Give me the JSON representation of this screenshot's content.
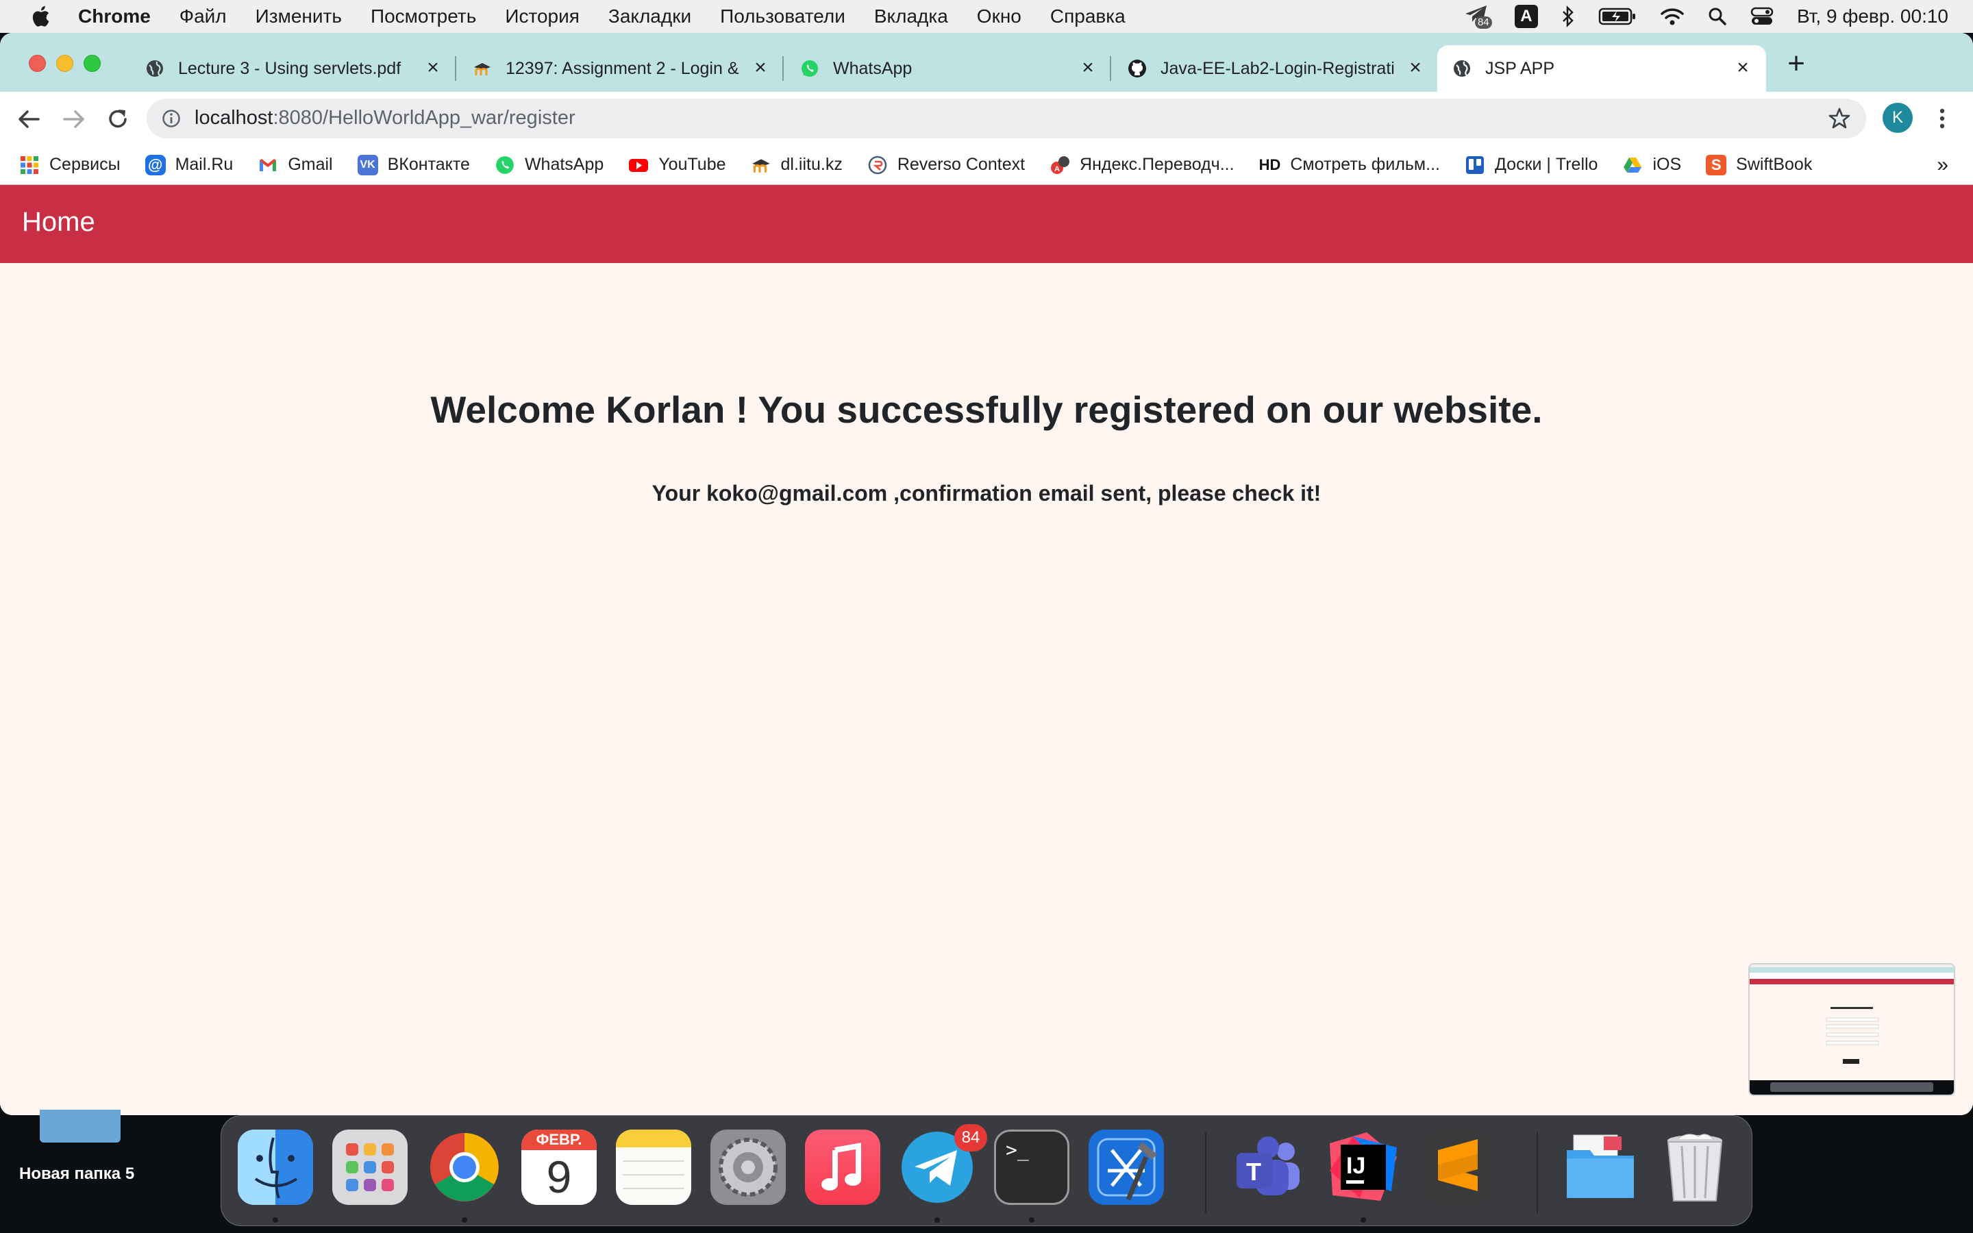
{
  "menubar": {
    "app_name": "Chrome",
    "items": [
      "Файл",
      "Изменить",
      "Посмотреть",
      "История",
      "Закладки",
      "Пользователи",
      "Вкладка",
      "Окно",
      "Справка"
    ],
    "status_badge": "84",
    "input_source": "A",
    "clock": "Вт, 9 февр.  00:10"
  },
  "tabs": [
    {
      "label": "Lecture 3 - Using servlets.pdf",
      "icon": "globe-icon"
    },
    {
      "label": "12397: Assignment 2 - Login &",
      "icon": "moodle-icon"
    },
    {
      "label": "WhatsApp",
      "icon": "whatsapp-icon"
    },
    {
      "label": "Java-EE-Lab2-Login-Registrati",
      "icon": "github-icon"
    },
    {
      "label": "JSP APP",
      "icon": "globe-icon",
      "active": true
    }
  ],
  "address": {
    "host": "localhost",
    "path": ":8080/HelloWorldApp_war/register"
  },
  "profile_initial": "K",
  "bookmarks": [
    {
      "label": "Сервисы",
      "icon": "apps-grid-icon"
    },
    {
      "label": "Mail.Ru",
      "icon": "mailru-icon"
    },
    {
      "label": "Gmail",
      "icon": "gmail-icon"
    },
    {
      "label": "ВКонтакте",
      "icon": "vk-icon"
    },
    {
      "label": "WhatsApp",
      "icon": "whatsapp-icon"
    },
    {
      "label": "YouTube",
      "icon": "youtube-icon"
    },
    {
      "label": "dl.iitu.kz",
      "icon": "moodle-icon"
    },
    {
      "label": "Reverso Context",
      "icon": "reverso-icon"
    },
    {
      "label": "Яндекс.Переводч...",
      "icon": "yandex-translate-icon"
    },
    {
      "label": "Смотреть фильм...",
      "icon": "hd-icon",
      "icon_text": "HD"
    },
    {
      "label": "Доски | Trello",
      "icon": "trello-icon"
    },
    {
      "label": "iOS",
      "icon": "google-drive-icon"
    },
    {
      "label": "SwiftBook",
      "icon": "swiftbook-icon"
    }
  ],
  "bookmarks_more": "»",
  "page": {
    "nav_brand": "Home",
    "headline": "Welcome Korlan ! You successfully registered on our website.",
    "subline": "Your koko@gmail.com ,confirmation email sent, please check it!",
    "accent_color": "#c92f44",
    "background_color": "#fff6f1"
  },
  "desktop": {
    "folder_label": "Новая папка 5"
  },
  "dock": {
    "apps": [
      "finder-icon",
      "launchpad-icon",
      "chrome-icon",
      "calendar-icon",
      "notes-icon",
      "system-preferences-icon",
      "music-icon",
      "telegram-icon",
      "terminal-icon",
      "xcode-icon",
      "teams-icon",
      "intellij-icon",
      "sublime-icon",
      "downloads-folder-icon",
      "trash-icon"
    ],
    "calendar_month": "ФЕВР.",
    "calendar_day": "9",
    "telegram_badge": "84",
    "terminal_prompt": ">_"
  }
}
